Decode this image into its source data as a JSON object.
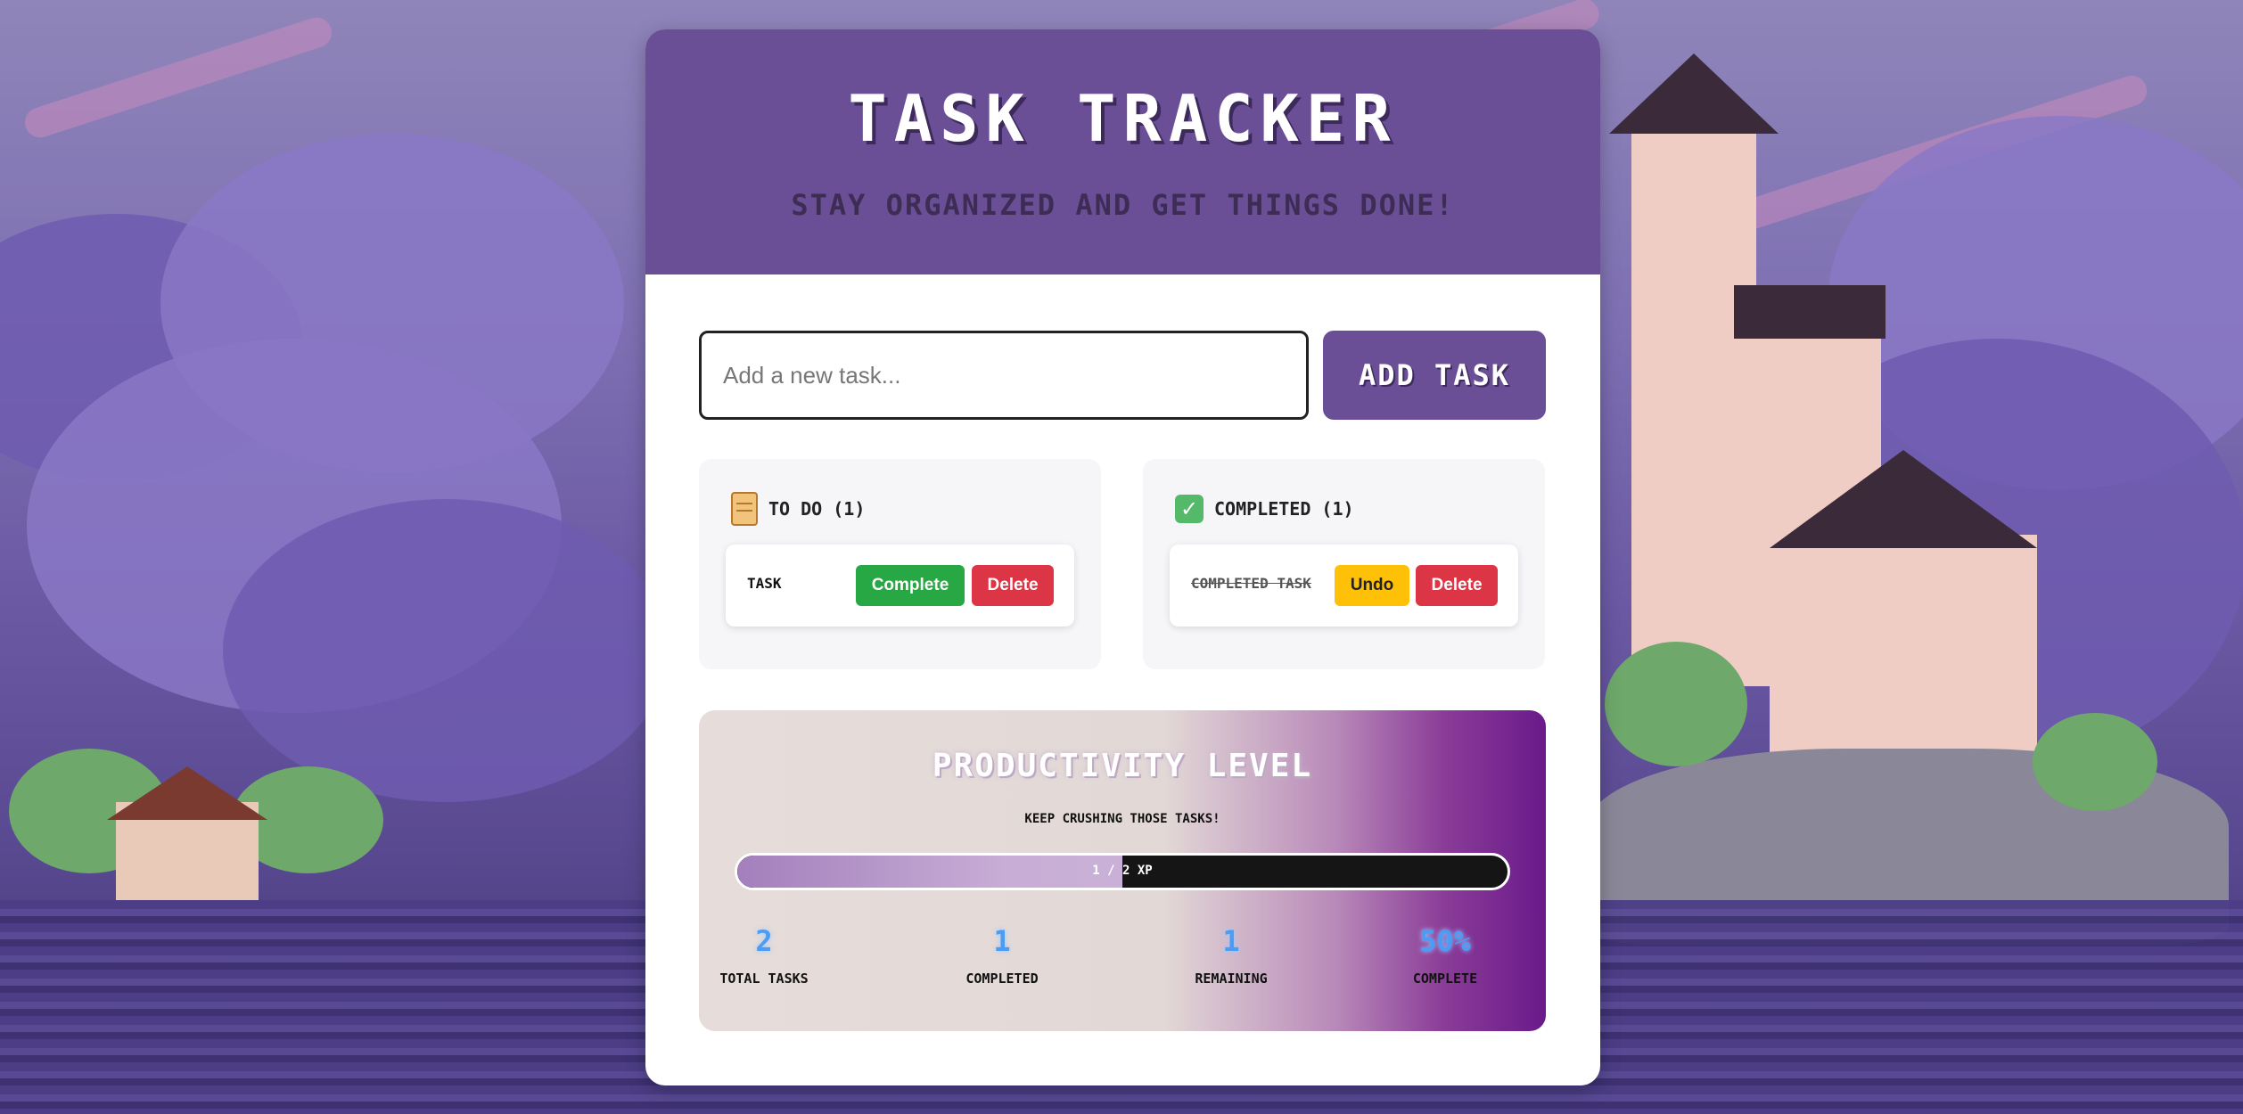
{
  "app": {
    "title": "Task Tracker",
    "subtitle": "Stay organized and get things done!"
  },
  "add_task": {
    "placeholder": "Add a new task...",
    "value": "",
    "button_label": "Add Task"
  },
  "todo": {
    "heading": "To Do (1)",
    "icon": "scroll-icon",
    "items": [
      {
        "name": "Task",
        "complete_label": "Complete",
        "delete_label": "Delete"
      }
    ]
  },
  "completed": {
    "heading": "Completed (1)",
    "icon": "check-icon",
    "items": [
      {
        "name": "Completed Task",
        "undo_label": "Undo",
        "delete_label": "Delete"
      }
    ]
  },
  "productivity": {
    "title": "Productivity Level",
    "subtitle": "Keep crushing those tasks!",
    "xp_label": "1 / 2 XP",
    "progress_fraction": 0.5,
    "stats": [
      {
        "value": "2",
        "label": "Total Tasks"
      },
      {
        "value": "1",
        "label": "Completed"
      },
      {
        "value": "1",
        "label": "Remaining"
      },
      {
        "value": "50%",
        "label": "Complete"
      }
    ]
  },
  "colors": {
    "primary": "#6a4e96",
    "complete": "#28a745",
    "delete": "#dc3545",
    "undo": "#ffc107",
    "stat_number": "#4a9cf5"
  }
}
